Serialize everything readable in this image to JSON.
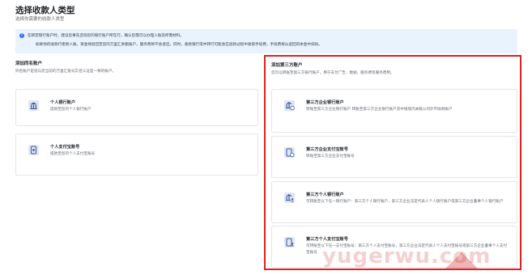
{
  "page": {
    "title": "选择收款人类型",
    "subtitle": "选择你需要的收款人类型"
  },
  "notice": {
    "icon": "info-icon",
    "line1": "在绑定银行账户时，建议您事先咨询您的银行账户所在行。确认您需可以办理入账及所需材料。",
    "line2": "如果你的收款行拒绝入账，资金将退回至您的万里汇余额账户，服务费将不会退还。同时，收款银行或中转行可能会在退款过程中收取手续费，手续费将从退回的本金中扣除。"
  },
  "left": {
    "title": "添加同名账户",
    "desc": "同名账户是指与您当前的万里汇账号实名认证是一致的账户。",
    "cards": [
      {
        "icon": "bank-icon",
        "title": "个人银行账户",
        "desc": "提款至您的个人银行账户"
      },
      {
        "icon": "alipay-icon",
        "title": "个人支付宝账号",
        "desc": "提款至您的个人支付宝账号"
      }
    ]
  },
  "right": {
    "title": "添加第三方账户",
    "desc": "您可以转账至第三方银行账户，用于支付广告、数据、服务费等服务费用。",
    "cards": [
      {
        "icon": "enterprise-bank-icon",
        "title": "第三方企业银行账户",
        "desc": "转账至第三方企业银行账户 转账至第三方企业银行账户及中银境内关联公司外币收款账户"
      },
      {
        "icon": "enterprise-alipay-icon",
        "title": "第三方企业支付宝账号",
        "desc": "转账至第三方企业支付宝账号"
      },
      {
        "icon": "personal-bank-icon",
        "title": "第三方个人银行账户",
        "desc": "可转账至以下任一银行账户：第三方个人银行账户，第三方企业法定代表人个人银行账户或第三方企业董事个人银行账户"
      },
      {
        "icon": "personal-alipay-icon",
        "title": "第三方个人支付宝账号",
        "desc": "可转账至以下任一支付宝账号：第三方个人支付宝账号，第三方企业法定代表人个人支付宝账号或第三方企业董事个人支付宝账号"
      }
    ]
  },
  "watermark": {
    "text": "yugerwu.com"
  },
  "colors": {
    "accent": "#3370ff",
    "highlight": "#e02020",
    "notice_bg": "#e8f3fe"
  }
}
